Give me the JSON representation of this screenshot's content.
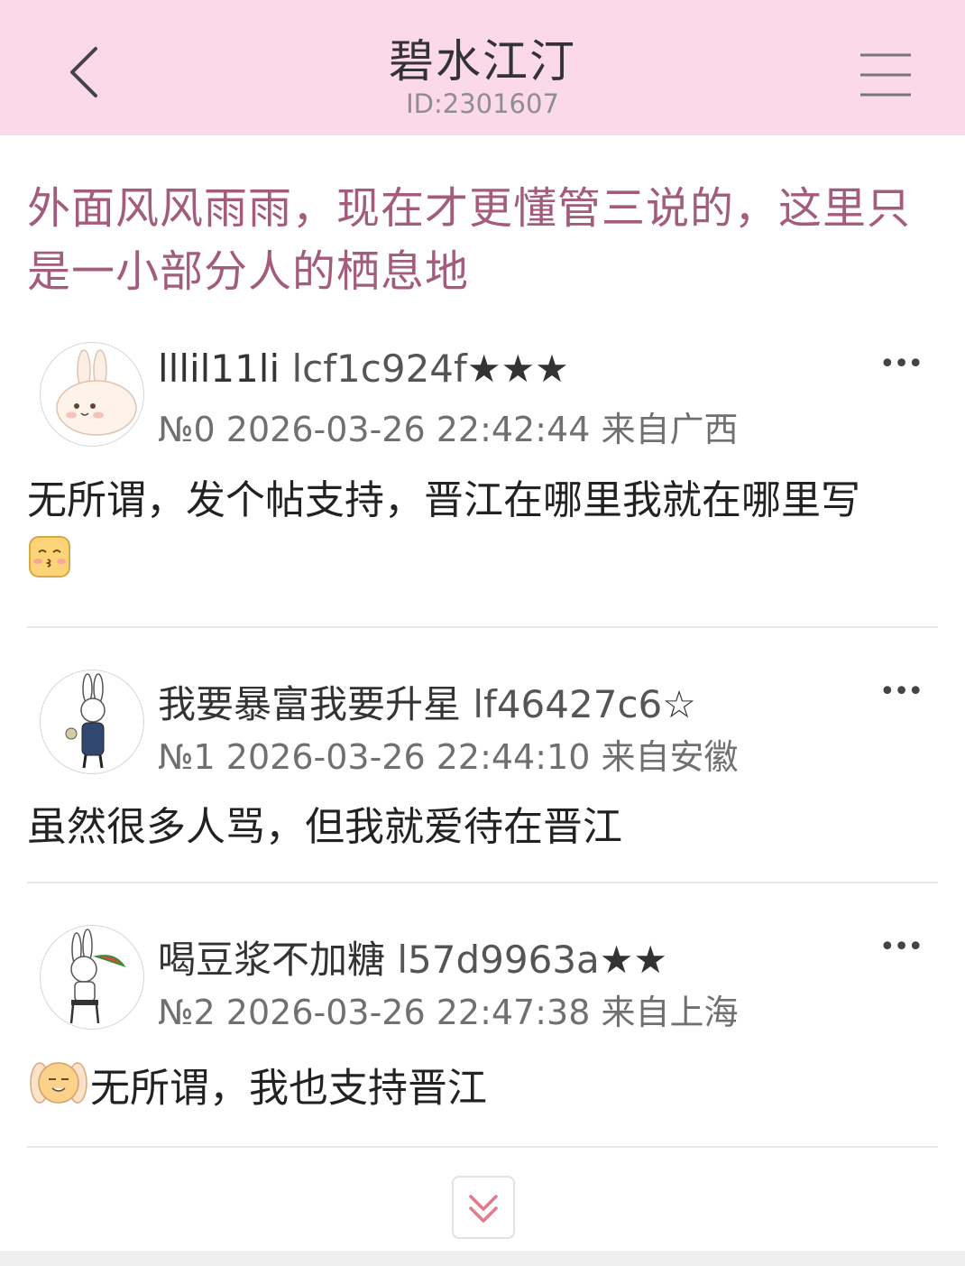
{
  "header": {
    "title": "碧水江汀",
    "id_text": "ID:2301607",
    "back_icon": "back-chevron-icon",
    "menu_icon": "hamburger-menu-icon"
  },
  "post": {
    "title": "外面风风雨雨，现在才更懂管三说的，这里只是一小部分人的栖息地"
  },
  "replies": [
    {
      "name": "lllil11li",
      "uid": "lcf1c924f",
      "stars": "★★★",
      "floor": "№0",
      "datetime": "2026-03-26 22:42:44",
      "location": "来自广西",
      "content": "无所谓，发个帖支持，晋江在哪里我就在哪里写",
      "avatar_icon": "bunny-avatar-icon",
      "emoji_icon": "kiss-face-emoji-icon"
    },
    {
      "name": "我要暴富我要升星",
      "uid": "lf46427c6",
      "stars": "☆",
      "floor": "№1",
      "datetime": "2026-03-26 22:44:10",
      "location": "来自安徽",
      "content": "虽然很多人骂，但我就爱待在晋江",
      "avatar_icon": "rabbit-overalls-avatar-icon"
    },
    {
      "name": "喝豆浆不加糖",
      "uid": "l57d9963a",
      "stars": "★★",
      "floor": "№2",
      "datetime": "2026-03-26 22:47:38",
      "location": "来自上海",
      "content": "无所谓，我也支持晋江",
      "avatar_icon": "rabbit-watermelon-avatar-icon",
      "emoji_icon": "bunny-hood-emoji-icon"
    }
  ],
  "more_label": "•••",
  "scroll_icon": "double-chevron-down-icon",
  "colors": {
    "header_bg": "#fbd9e9",
    "title_color": "#a35c7c"
  }
}
